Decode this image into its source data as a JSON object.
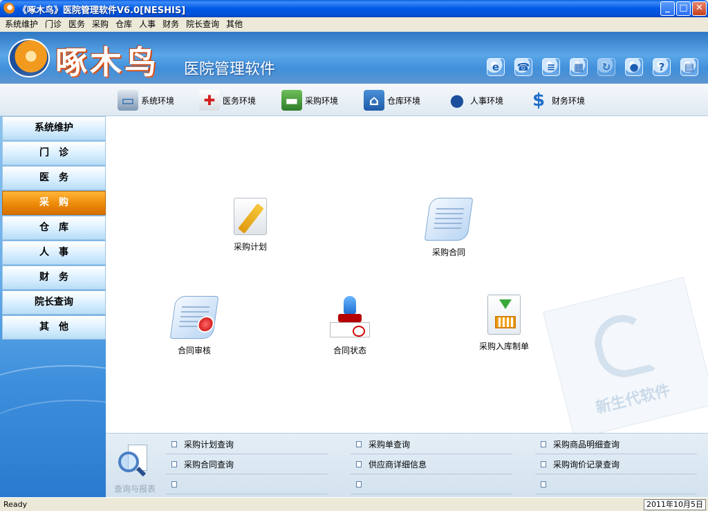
{
  "window": {
    "title": "《啄木鸟》医院管理软件V6.0[NESHIS]",
    "buttons": {
      "minimize": "_",
      "maximize": "□",
      "close": "✕"
    }
  },
  "menu": [
    "系统维护",
    "门诊",
    "医务",
    "采购",
    "仓库",
    "人事",
    "财务",
    "院长查询",
    "其他"
  ],
  "banner": {
    "logo_name": "啄木鸟",
    "subtitle": "医院管理软件",
    "tools": [
      "ie-icon",
      "phone-icon",
      "notepad-icon",
      "calculator-icon",
      "refresh-icon",
      "chat-icon",
      "help-icon",
      "books-icon"
    ]
  },
  "environments": [
    {
      "label": "系统环境",
      "icon": "monitor-icon"
    },
    {
      "label": "医务环境",
      "icon": "ambulance-icon"
    },
    {
      "label": "采购环境",
      "icon": "truck-icon"
    },
    {
      "label": "仓库环境",
      "icon": "warehouse-icon"
    },
    {
      "label": "人事环境",
      "icon": "person-icon"
    },
    {
      "label": "财务环境",
      "icon": "dollar-icon"
    }
  ],
  "sidebar": {
    "items": [
      {
        "label": "系统维护"
      },
      {
        "label": "门　诊"
      },
      {
        "label": "医　务"
      },
      {
        "label": "采　购",
        "active": true
      },
      {
        "label": "仓　库"
      },
      {
        "label": "人　事"
      },
      {
        "label": "财　务"
      },
      {
        "label": "院长查询"
      },
      {
        "label": "其　他"
      }
    ]
  },
  "features": [
    {
      "label": "采购计划",
      "icon": "plan-pencil-icon"
    },
    {
      "label": "采购合同",
      "icon": "contract-scroll-icon"
    },
    {
      "label": "合同审核",
      "icon": "contract-seal-icon"
    },
    {
      "label": "合同状态",
      "icon": "stamp-icon"
    },
    {
      "label": "采购入库制单",
      "icon": "cart-download-icon"
    }
  ],
  "watermark": {
    "text": "新生代软件"
  },
  "query_panel": {
    "label": "查询与报表",
    "links": [
      [
        "采购计划查询",
        "采购单查询",
        "采购商品明细查询"
      ],
      [
        "采购合同查询",
        "供应商详细信息",
        "采购询价记录查询"
      ],
      [
        "",
        "",
        ""
      ]
    ]
  },
  "status": {
    "text": "Ready",
    "date": "2011年10月5日"
  }
}
